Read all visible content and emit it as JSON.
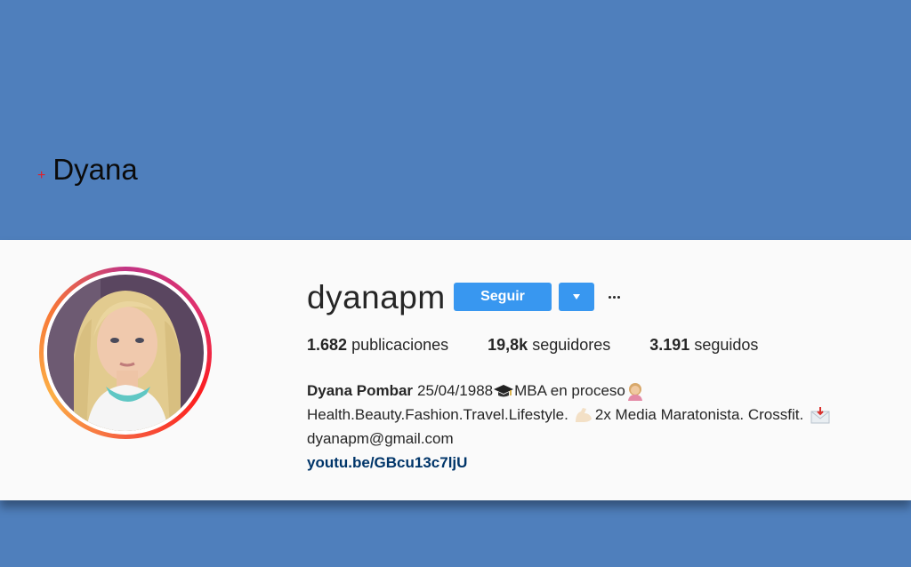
{
  "slide": {
    "bullet": "+",
    "title": "Dyana"
  },
  "profile": {
    "username": "dyanapm",
    "follow_label": "Seguir",
    "dropdown_icon": "triangle-down-icon",
    "more_icon": "ellipsis-icon",
    "stats": {
      "posts_count": "1.682",
      "posts_label": "publicaciones",
      "followers_count": "19,8k",
      "followers_label": "seguidores",
      "following_count": "3.191",
      "following_label": "seguidos"
    },
    "bio": {
      "name": "Dyana Pombar",
      "line1_after_name": "25/04/1988",
      "line1_after_cap": "MBA en proceso",
      "line2_text": "Health.Beauty.Fashion.Travel.Lifestyle.",
      "line2_after_arm": "2x Media Maratonista. Crossfit.",
      "line3_email": "dyanapm@gmail.com",
      "link": "youtu.be/GBcu13c7ljU"
    },
    "colors": {
      "button_blue": "#3897f0",
      "link_dark_blue": "#003569",
      "slide_background": "#4f7fbc"
    }
  }
}
